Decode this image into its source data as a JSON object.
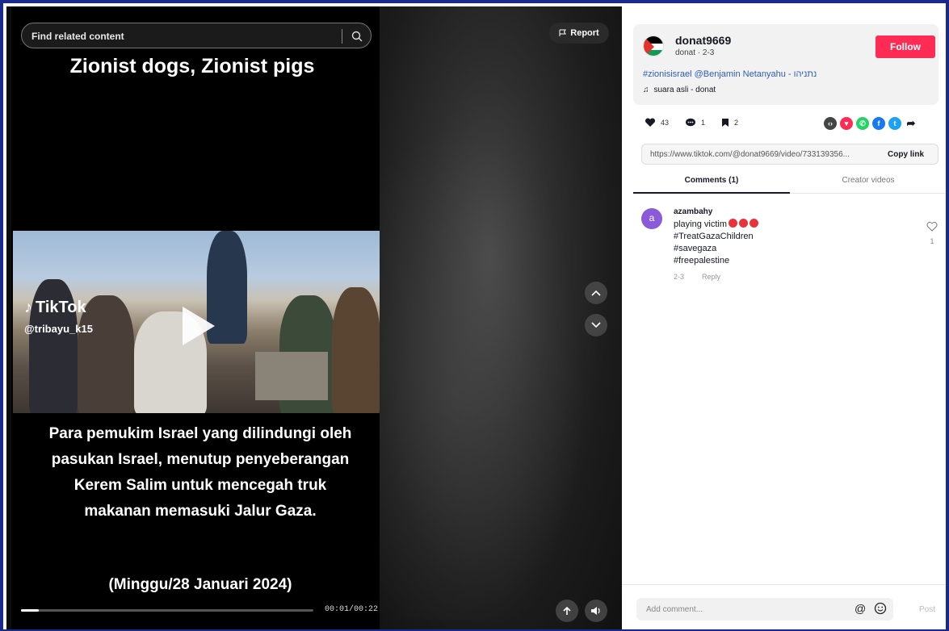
{
  "search": {
    "placeholder": "Find related content"
  },
  "report": {
    "label": "Report"
  },
  "video": {
    "headline": "Zionist dogs, Zionist pigs",
    "watermark_brand": "TikTok",
    "watermark_user": "@tribayu_k15",
    "caption": "Para pemukim Israel yang dilindungi oleh pasukan Israel, menutup penyeberangan Kerem Salim untuk mencegah truk makanan memasuki Jalur Gaza.",
    "date_caption": "(Minggu/28 Januari 2024)",
    "time": "00:01/00:22",
    "progress_fraction": 0.06
  },
  "post": {
    "username": "donat9669",
    "subtitle": "donat · 2-3",
    "follow_label": "Follow",
    "description": "#zionisisrael @Benjamin Netanyahu - נתניהו",
    "sound": "suara asli - donat",
    "likes": "43",
    "comments": "1",
    "saves": "2",
    "link": "https://www.tiktok.com/@donat9669/video/733139356...",
    "copy_label": "Copy link"
  },
  "tabs": {
    "comments": "Comments (1)",
    "creator": "Creator videos"
  },
  "comment": {
    "avatar_letter": "a",
    "user": "azambahy",
    "line1": "playing victim",
    "line2": "#TreatGazaChildren",
    "line3": "#savegaza",
    "line4": "#freepalestine",
    "date": "2-3",
    "reply": "Reply",
    "like_count": "1"
  },
  "composer": {
    "placeholder": "Add comment...",
    "post_label": "Post",
    "mention": "@"
  },
  "colors": {
    "follow": "#fe2c55",
    "frame_border": "#1a2a8c",
    "link_blue": "#2b5db9"
  },
  "icons": [
    "search-icon",
    "flag-icon",
    "play-icon",
    "chevron-up-icon",
    "chevron-down-icon",
    "volume-icon",
    "float-icon",
    "heart-icon",
    "comment-icon",
    "bookmark-icon",
    "embed-icon",
    "share-icon",
    "emoji-icon",
    "music-note-icon"
  ]
}
